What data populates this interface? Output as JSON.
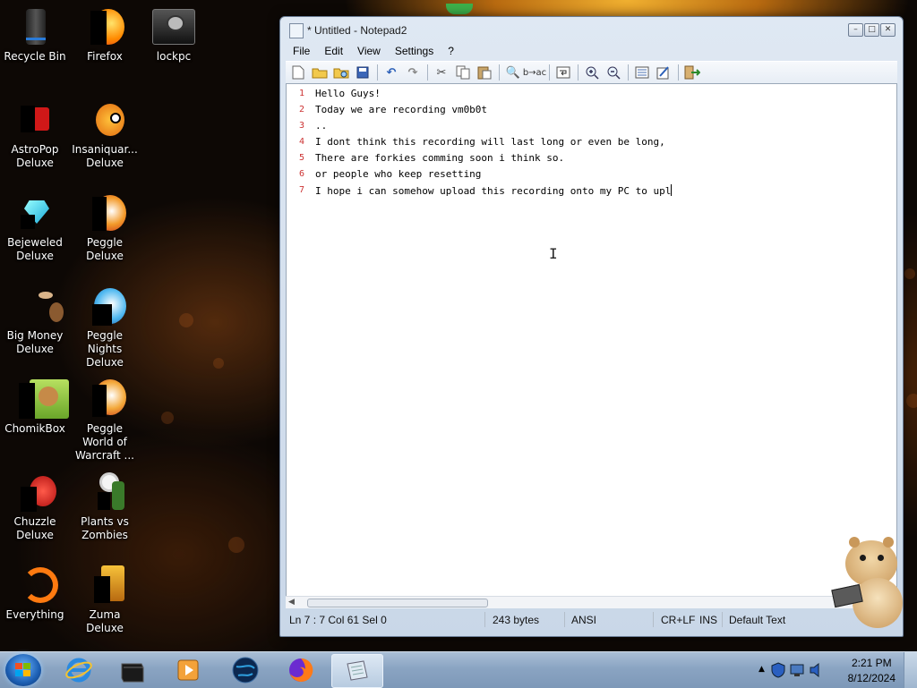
{
  "desktop": {
    "icons": [
      {
        "label": "Recycle Bin",
        "icon": "recycle-bin-icon"
      },
      {
        "label": "Firefox",
        "icon": "firefox-icon"
      },
      {
        "label": "lockpc",
        "icon": "lockpc-icon"
      },
      {
        "label": "AstroPop Deluxe",
        "icon": "astropop-icon"
      },
      {
        "label": "Insaniquar... Deluxe",
        "icon": "insaniquarium-icon"
      },
      {
        "label": "Bejeweled Deluxe",
        "icon": "bejeweled-icon"
      },
      {
        "label": "Peggle Deluxe",
        "icon": "peggle-icon"
      },
      {
        "label": "Big Money Deluxe",
        "icon": "big-money-icon"
      },
      {
        "label": "Peggle Nights Deluxe",
        "icon": "peggle-nights-icon"
      },
      {
        "label": "ChomikBox",
        "icon": "chomikbox-icon"
      },
      {
        "label": "Peggle World of Warcraft ...",
        "icon": "peggle-wow-icon"
      },
      {
        "label": "Chuzzle Deluxe",
        "icon": "chuzzle-icon"
      },
      {
        "label": "Plants vs Zombies",
        "icon": "plants-vs-zombies-icon"
      },
      {
        "label": "Everything",
        "icon": "everything-icon"
      },
      {
        "label": "Zuma Deluxe",
        "icon": "zuma-icon"
      }
    ]
  },
  "window": {
    "title": "* Untitled - Notepad2",
    "menu": [
      "File",
      "Edit",
      "View",
      "Settings",
      "?"
    ],
    "toolbar_icons": [
      "new-icon",
      "open-icon",
      "browse-icon",
      "save-icon",
      "undo-icon",
      "redo-icon",
      "cut-icon",
      "copy-icon",
      "paste-icon",
      "find-icon",
      "replace-icon",
      "word-wrap-icon",
      "zoom-in-icon",
      "zoom-out-icon",
      "scheme-icon",
      "customize-icon",
      "exit-icon"
    ],
    "lines": [
      {
        "num": "1",
        "text": "Hello Guys!"
      },
      {
        "num": "2",
        "text": "Today we are recording vm0b0t"
      },
      {
        "num": "3",
        "text": ".."
      },
      {
        "num": "4",
        "text": "I dont think this recording will last long or even be long,"
      },
      {
        "num": "5",
        "text": "There are forkies comming soon i think so."
      },
      {
        "num": "6",
        "text": "or people who keep resetting"
      },
      {
        "num": "7",
        "text": "I hope i can somehow upload this recording onto my PC to upl"
      }
    ],
    "status": {
      "position": "Ln 7 : 7   Col 61   Sel 0",
      "size": "243 bytes",
      "encoding": "ANSI",
      "eol": "CR+LF",
      "mode": "INS",
      "scheme": "Default Text"
    }
  },
  "taskbar": {
    "pinned": [
      "internet-explorer-icon",
      "vmware-icon",
      "media-player-icon",
      "globe-icon",
      "firefox-icon",
      "notepad2-icon"
    ],
    "clock": {
      "time": "2:21 PM",
      "date": "8/12/2024"
    }
  }
}
